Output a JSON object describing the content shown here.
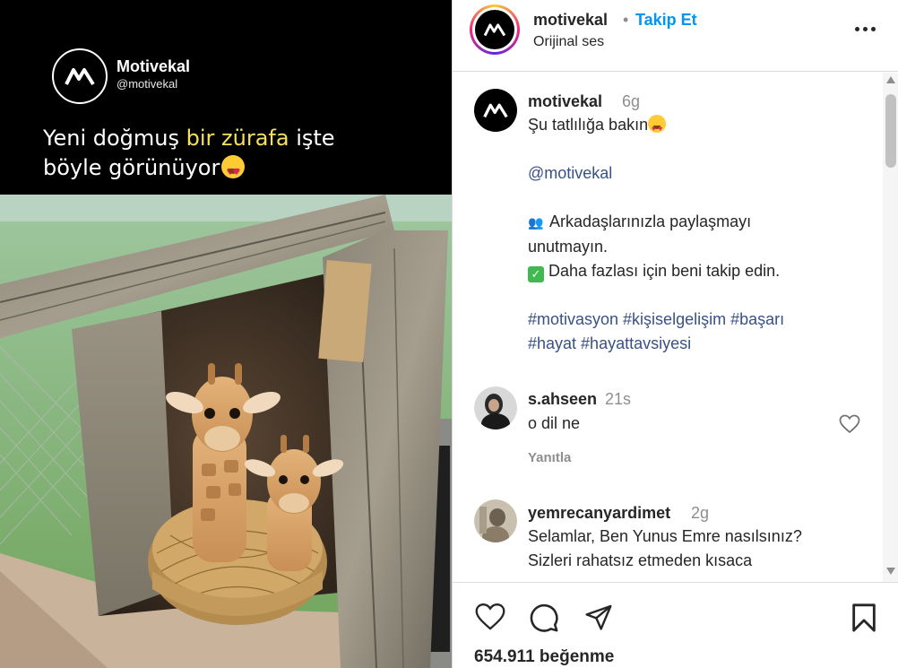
{
  "media": {
    "watermark_name": "Motivekal",
    "watermark_handle": "@motivekal",
    "headline_part1": "Yeni doğmuş ",
    "headline_highlight": "bir zürafa",
    "headline_part2": " işte",
    "headline_line2": "böyle görünüyor",
    "headline_emoji": "smiling-face-with-heart-eyes"
  },
  "header": {
    "username": "motivekal",
    "separator": "•",
    "follow_label": "Takip Et",
    "audio_label": "Orijinal ses",
    "follow_color": "#0095f6"
  },
  "caption": {
    "username": "motivekal",
    "time": "6g",
    "line1": "Şu tatlılığa bakın",
    "mention": "@motivekal",
    "share_line1": "Arkadaşlarınızla paylaşmayı",
    "share_line2": "unutmayın.",
    "follow_line": "Daha fazlası için beni takip edin.",
    "hashtags_line1": "#motivasyon #kişiselgelişim #başarı",
    "hashtags_line2": "#hayat #hayattavsiyesi",
    "link_color": "#385185"
  },
  "comments": [
    {
      "username": "s.ahseen",
      "time": "21s",
      "text": "o dil ne",
      "reply_label": "Yanıtla"
    },
    {
      "username": "yemrecanyardimet",
      "time": "2g",
      "line1": "Selamlar, Ben Yunus Emre nasılsınız?",
      "line2": "Sizleri rahatsız etmeden kısaca"
    }
  ],
  "footer": {
    "likes": "654.911 beğenme"
  }
}
